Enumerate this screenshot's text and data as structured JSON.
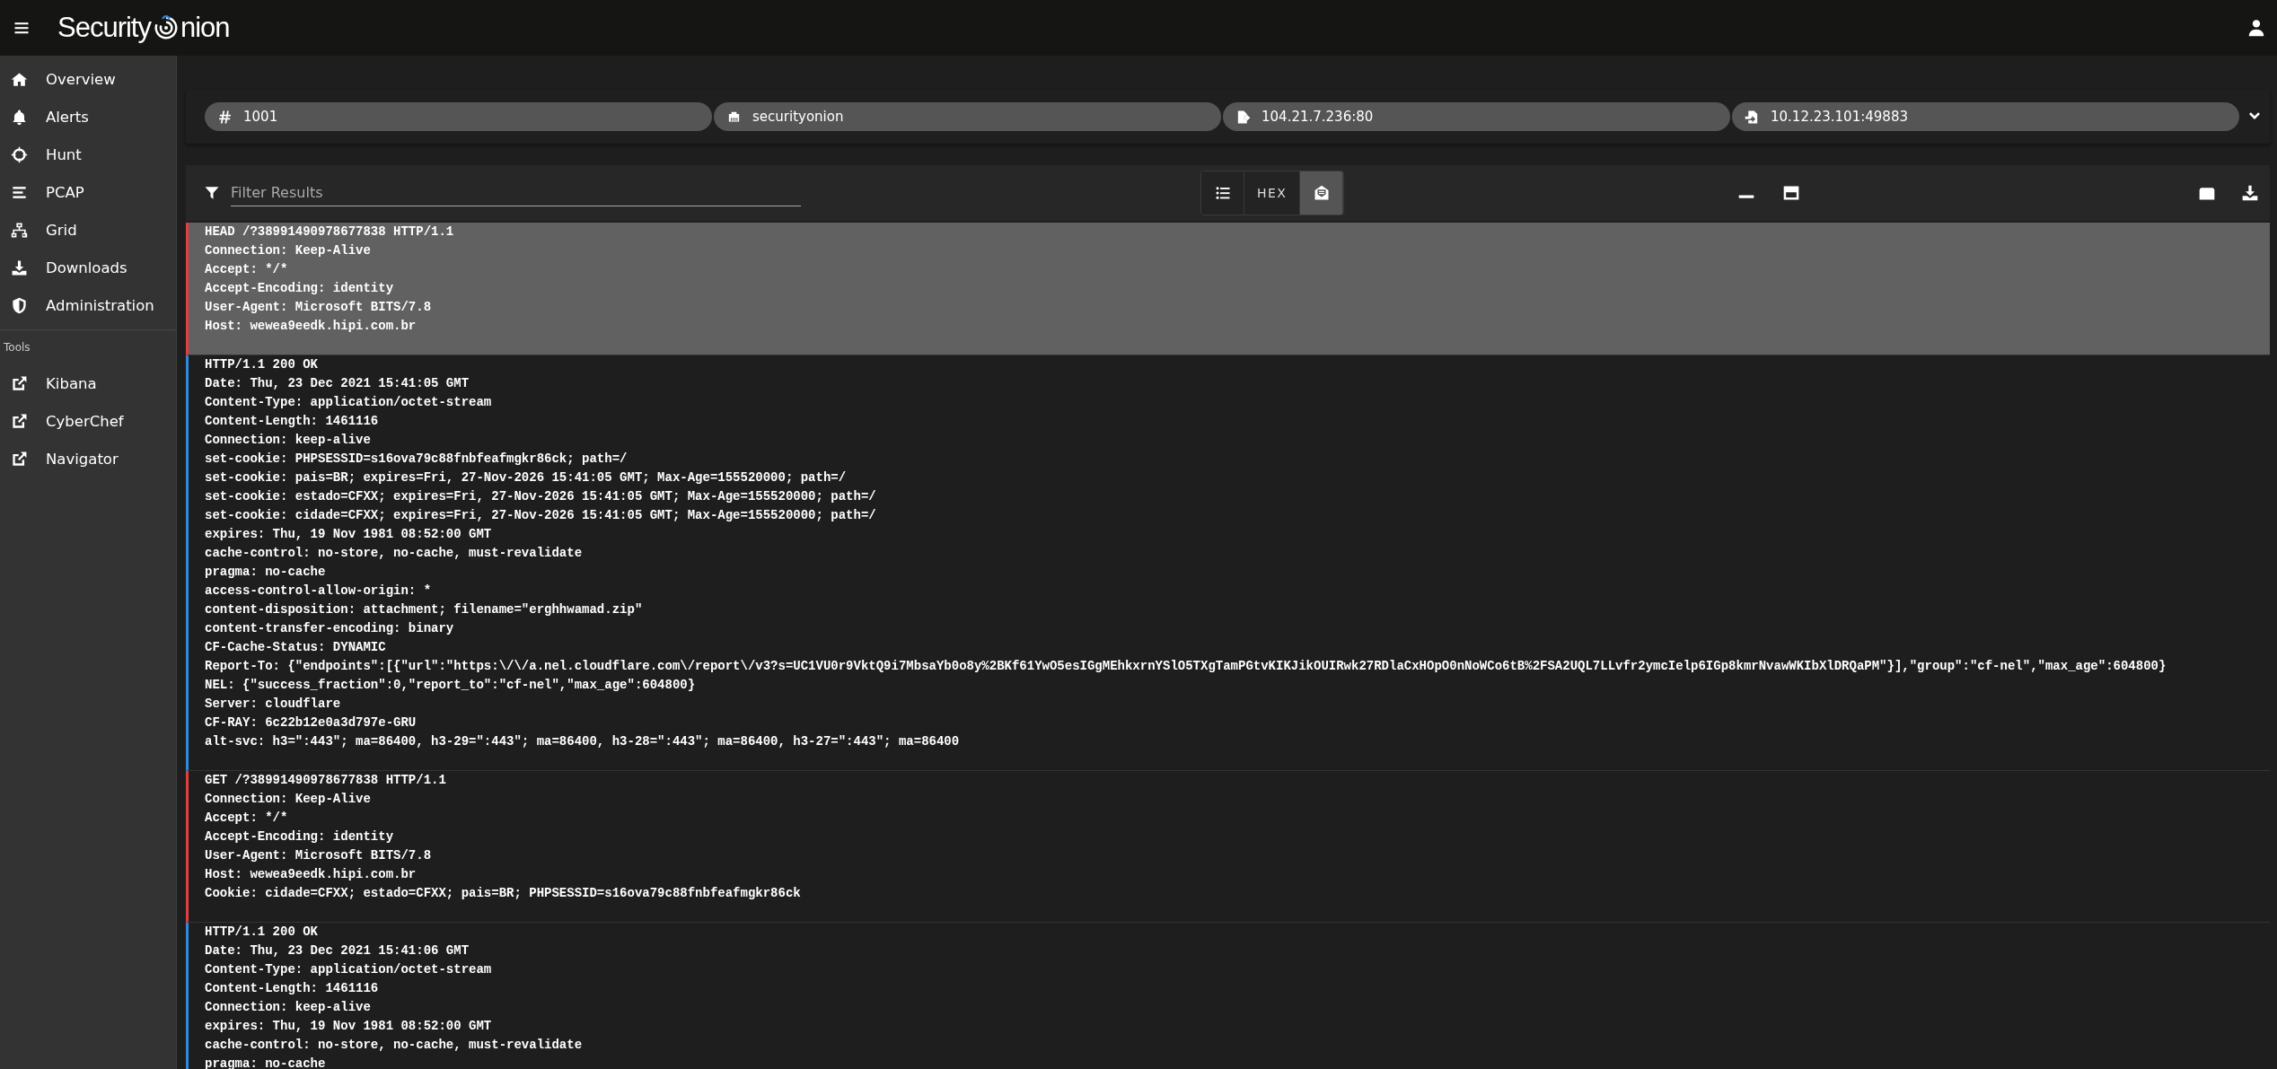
{
  "header": {
    "brand": [
      "Security",
      "nion"
    ]
  },
  "sidebar": {
    "items": [
      {
        "label": "Overview",
        "kind": "home"
      },
      {
        "label": "Alerts",
        "kind": "bell"
      },
      {
        "label": "Hunt",
        "kind": "crosshair"
      },
      {
        "label": "PCAP",
        "kind": "bars"
      },
      {
        "label": "Grid",
        "kind": "network"
      },
      {
        "label": "Downloads",
        "kind": "download"
      },
      {
        "label": "Administration",
        "kind": "shield"
      }
    ],
    "tools_heading": "Tools",
    "tools": [
      {
        "label": "Kibana"
      },
      {
        "label": "CyberChef"
      },
      {
        "label": "Navigator"
      }
    ]
  },
  "chips": [
    {
      "kind": "hash",
      "text": "1001"
    },
    {
      "kind": "ethernet",
      "text": "securityonion"
    },
    {
      "kind": "source",
      "text": "104.21.7.236:80"
    },
    {
      "kind": "destination",
      "text": "10.12.23.101:49883"
    }
  ],
  "filter": {
    "placeholder": "Filter Results"
  },
  "view_buttons": [
    {
      "kind": "list",
      "selected": false
    },
    {
      "kind": "hex",
      "text": "HEX",
      "selected": false
    },
    {
      "kind": "envelope",
      "selected": true
    }
  ],
  "packets": [
    {
      "kind": "request",
      "selected": true,
      "lines": [
        "HEAD /?38991490978677838 HTTP/1.1",
        "Connection: Keep-Alive",
        "Accept: */*",
        "Accept-Encoding: identity",
        "User-Agent: Microsoft BITS/7.8",
        "Host: wewea9eedk.hipi.com.br"
      ]
    },
    {
      "kind": "response",
      "selected": false,
      "lines": [
        "HTTP/1.1 200 OK",
        "Date: Thu, 23 Dec 2021 15:41:05 GMT",
        "Content-Type: application/octet-stream",
        "Content-Length: 1461116",
        "Connection: keep-alive",
        "set-cookie: PHPSESSID=s16ova79c88fnbfeafmgkr86ck; path=/",
        "set-cookie: pais=BR; expires=Fri, 27-Nov-2026 15:41:05 GMT; Max-Age=155520000; path=/",
        "set-cookie: estado=CFXX; expires=Fri, 27-Nov-2026 15:41:05 GMT; Max-Age=155520000; path=/",
        "set-cookie: cidade=CFXX; expires=Fri, 27-Nov-2026 15:41:05 GMT; Max-Age=155520000; path=/",
        "expires: Thu, 19 Nov 1981 08:52:00 GMT",
        "cache-control: no-store, no-cache, must-revalidate",
        "pragma: no-cache",
        "access-control-allow-origin: *",
        "content-disposition: attachment; filename=\"erghhwamad.zip\"",
        "content-transfer-encoding: binary",
        "CF-Cache-Status: DYNAMIC",
        "Report-To: {\"endpoints\":[{\"url\":\"https:\\/\\/a.nel.cloudflare.com\\/report\\/v3?s=UC1VU0r9VktQ9i7MbsaYb0o8y%2BKf61YwO5esIGgMEhkxrnYSlO5TXgTamPGtvKIKJikOUIRwk27RDlaCxHOpO0nNoWCo6tB%2FSA2UQL7LLvfr2ymcIelp6IGp8kmrNvawWKIbXlDRQaPM\"}],\"group\":\"cf-nel\",\"max_age\":604800}",
        "NEL: {\"success_fraction\":0,\"report_to\":\"cf-nel\",\"max_age\":604800}",
        "Server: cloudflare",
        "CF-RAY: 6c22b12e0a3d797e-GRU",
        "alt-svc: h3=\":443\"; ma=86400, h3-29=\":443\"; ma=86400, h3-28=\":443\"; ma=86400, h3-27=\":443\"; ma=86400"
      ]
    },
    {
      "kind": "request",
      "selected": false,
      "lines": [
        "GET /?38991490978677838 HTTP/1.1",
        "Connection: Keep-Alive",
        "Accept: */*",
        "Accept-Encoding: identity",
        "User-Agent: Microsoft BITS/7.8",
        "Host: wewea9eedk.hipi.com.br",
        "Cookie: cidade=CFXX; estado=CFXX; pais=BR; PHPSESSID=s16ova79c88fnbfeafmgkr86ck"
      ]
    },
    {
      "kind": "response",
      "selected": false,
      "lines": [
        "HTTP/1.1 200 OK",
        "Date: Thu, 23 Dec 2021 15:41:06 GMT",
        "Content-Type: application/octet-stream",
        "Content-Length: 1461116",
        "Connection: keep-alive",
        "expires: Thu, 19 Nov 1981 08:52:00 GMT",
        "cache-control: no-store, no-cache, must-revalidate",
        "pragma: no-cache"
      ]
    }
  ]
}
